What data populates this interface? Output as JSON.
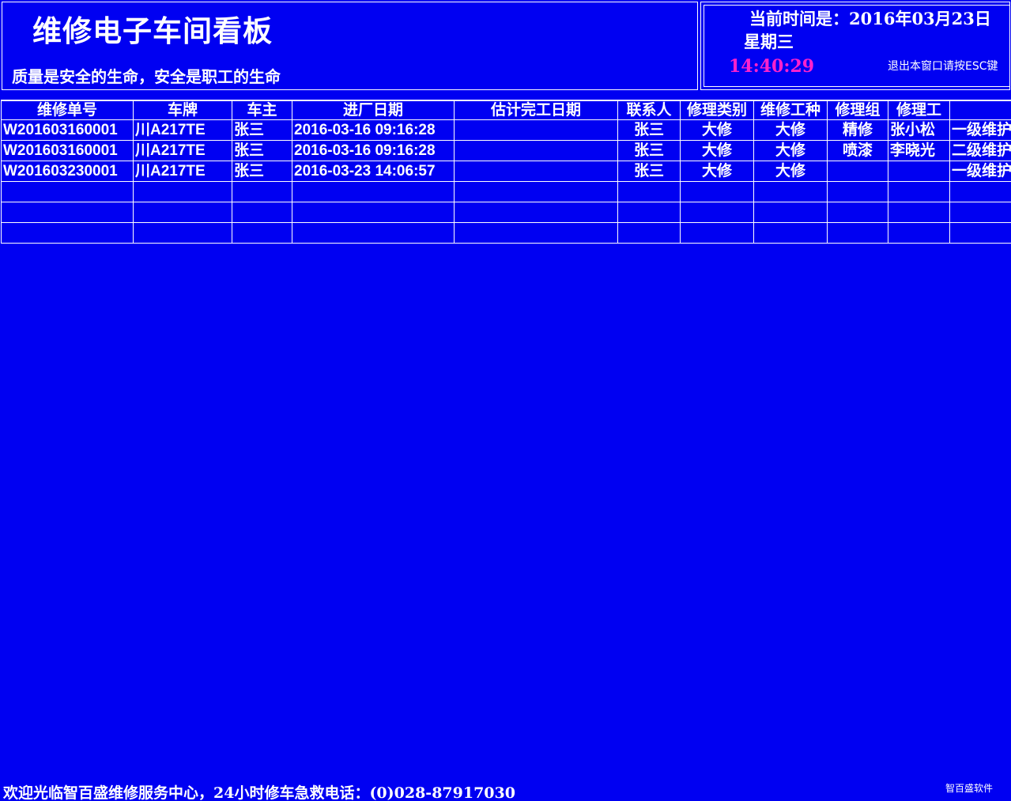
{
  "header": {
    "title": "维修电子车间看板",
    "slogan": "质量是安全的生命，安全是职工的生命"
  },
  "clock_panel": {
    "current_time_label": "当前时间是：2016年03月23日",
    "weekday": "星期三",
    "time": "14:40:29",
    "esc_hint": "退出本窗口请按ESC键",
    "time_color": "#ff22cc"
  },
  "table": {
    "columns": [
      "维修单号",
      "车牌",
      "车主",
      "进厂日期",
      "估计完工日期",
      "联系人",
      "修理类别",
      "维修工种",
      "修理组",
      "修理工",
      ""
    ],
    "rows": [
      [
        "W201603160001",
        "川A217TE",
        "张三",
        "2016-03-16 09:16:28",
        "",
        "张三",
        "大修",
        "大修",
        "精修",
        "张小松",
        "一级维护"
      ],
      [
        "W201603160001",
        "川A217TE",
        "张三",
        "2016-03-16 09:16:28",
        "",
        "张三",
        "大修",
        "大修",
        "喷漆",
        "李晓光",
        "二级维护"
      ],
      [
        "W201603230001",
        "川A217TE",
        "张三",
        "2016-03-23 14:06:57",
        "",
        "张三",
        "大修",
        "大修",
        "",
        "",
        "一级维护"
      ],
      [
        "",
        "",
        "",
        "",
        "",
        "",
        "",
        "",
        "",
        "",
        ""
      ],
      [
        "",
        "",
        "",
        "",
        "",
        "",
        "",
        "",
        "",
        "",
        ""
      ],
      [
        "",
        "",
        "",
        "",
        "",
        "",
        "",
        "",
        "",
        "",
        ""
      ]
    ]
  },
  "footer": {
    "marquee": "欢迎光临智百盛维修服务中心，24小时修车急救电话：(0)028-87917030",
    "brand": "智百盛软件"
  },
  "colors": {
    "background": "#0000f2",
    "text": "#ffffff",
    "grid_line": "#ffffff"
  }
}
